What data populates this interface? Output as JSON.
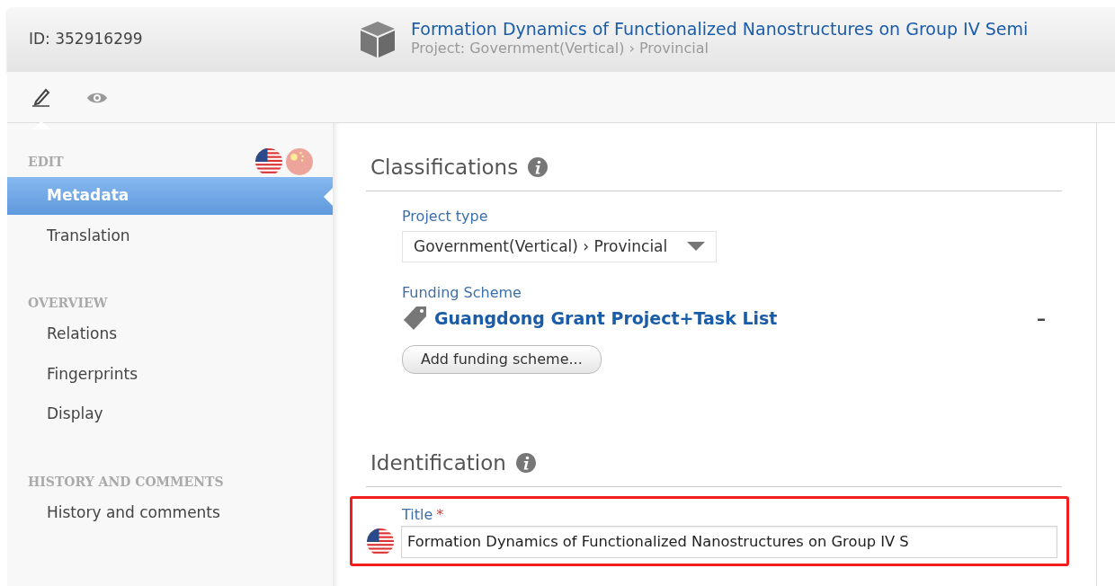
{
  "header": {
    "id_label": "ID: 352916299",
    "title": "Formation Dynamics of Functionalized Nanostructures on Group IV Semi",
    "subtitle": "Project: Government(Vertical) › Provincial"
  },
  "toolbar": {
    "tabs": [
      {
        "kind": "edit",
        "selected": true
      },
      {
        "kind": "view",
        "selected": false
      }
    ]
  },
  "sidebar": {
    "languages": [
      {
        "kind": "us",
        "selected": true
      },
      {
        "kind": "cn",
        "selected": false
      }
    ],
    "sections": [
      {
        "heading": "EDIT",
        "items": [
          {
            "label": "Metadata",
            "selected": true
          },
          {
            "label": "Translation",
            "selected": false
          }
        ]
      },
      {
        "heading": "OVERVIEW",
        "items": [
          {
            "label": "Relations",
            "selected": false
          },
          {
            "label": "Fingerprints",
            "selected": false
          },
          {
            "label": "Display",
            "selected": false
          }
        ]
      },
      {
        "heading": "HISTORY AND COMMENTS",
        "items": [
          {
            "label": "History and comments",
            "selected": false
          }
        ]
      }
    ]
  },
  "classifications": {
    "heading": "Classifications",
    "project_type": {
      "label": "Project type",
      "value": "Government(Vertical) › Provincial"
    },
    "funding_scheme": {
      "label": "Funding Scheme",
      "value": "Guangdong Grant Project+Task List",
      "remove": "–",
      "add_button": "Add funding scheme..."
    }
  },
  "identification": {
    "heading": "Identification",
    "title_field": {
      "label": "Title",
      "required_mark": "*",
      "highlighted": true,
      "value": "Formation Dynamics of Functionalized Nanostructures on Group IV S"
    }
  }
}
